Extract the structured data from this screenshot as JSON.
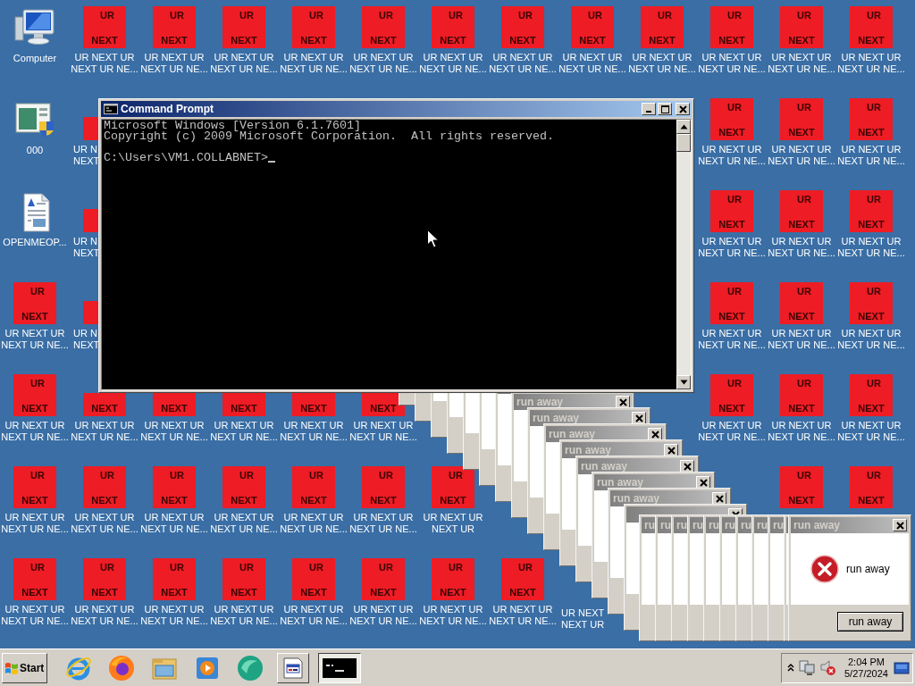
{
  "desktop": {
    "rows": [
      [
        {
          "kind": "computer",
          "label": [
            "Computer"
          ]
        },
        {
          "kind": "ur",
          "top": "UR",
          "bottom": "NEXT",
          "label": [
            "UR NEXT UR",
            "NEXT UR NE..."
          ]
        },
        {
          "kind": "ur",
          "top": "UR",
          "bottom": "NEXT",
          "label": [
            "UR NEXT UR",
            "NEXT UR NE..."
          ]
        },
        {
          "kind": "ur",
          "top": "UR",
          "bottom": "NEXT",
          "label": [
            "UR NEXT UR",
            "NEXT UR NE..."
          ]
        },
        {
          "kind": "ur",
          "top": "UR",
          "bottom": "NEXT",
          "label": [
            "UR NEXT UR",
            "NEXT UR NE..."
          ]
        },
        {
          "kind": "ur",
          "top": "UR",
          "bottom": "NEXT",
          "label": [
            "UR NEXT UR",
            "NEXT UR NE..."
          ]
        },
        {
          "kind": "ur",
          "top": "UR",
          "bottom": "NEXT",
          "label": [
            "UR NEXT UR",
            "NEXT UR NE..."
          ]
        },
        {
          "kind": "ur",
          "top": "UR",
          "bottom": "NEXT",
          "label": [
            "UR NEXT UR",
            "NEXT UR NE..."
          ]
        },
        {
          "kind": "ur",
          "top": "UR",
          "bottom": "NEXT",
          "label": [
            "UR NEXT UR",
            "NEXT UR NE..."
          ]
        },
        {
          "kind": "ur",
          "top": "UR",
          "bottom": "NEXT",
          "label": [
            "UR NEXT UR",
            "NEXT UR NE..."
          ]
        },
        {
          "kind": "ur",
          "top": "UR",
          "bottom": "NEXT",
          "label": [
            "UR NEXT UR",
            "NEXT UR NE..."
          ]
        },
        {
          "kind": "ur",
          "top": "UR",
          "bottom": "NEXT",
          "label": [
            "UR NEXT UR",
            "NEXT UR NE..."
          ]
        },
        {
          "kind": "ur",
          "top": "UR",
          "bottom": "NEXT",
          "label": [
            "UR NEXT UR",
            "NEXT UR NE..."
          ]
        }
      ],
      [
        {
          "kind": "program",
          "label": [
            "000"
          ]
        },
        {
          "kind": "ur-cut",
          "label": [
            "UR N",
            "NEXT"
          ]
        },
        {
          "kind": "empty"
        },
        {
          "kind": "empty"
        },
        {
          "kind": "empty"
        },
        {
          "kind": "empty"
        },
        {
          "kind": "empty"
        },
        {
          "kind": "empty"
        },
        {
          "kind": "empty"
        },
        {
          "kind": "empty"
        },
        {
          "kind": "ur",
          "top": "UR",
          "bottom": "NEXT",
          "label": [
            "UR NEXT UR",
            "NEXT UR NE..."
          ]
        },
        {
          "kind": "ur",
          "top": "UR",
          "bottom": "NEXT",
          "label": [
            "UR NEXT UR",
            "NEXT UR NE..."
          ]
        },
        {
          "kind": "ur",
          "top": "UR",
          "bottom": "NEXT",
          "label": [
            "UR NEXT UR",
            "NEXT UR NE..."
          ]
        }
      ],
      [
        {
          "kind": "document",
          "label": [
            "OPENMEOP..."
          ]
        },
        {
          "kind": "ur-cut",
          "label": [
            "UR N",
            "NEXT"
          ]
        },
        {
          "kind": "empty"
        },
        {
          "kind": "empty"
        },
        {
          "kind": "empty"
        },
        {
          "kind": "empty"
        },
        {
          "kind": "empty"
        },
        {
          "kind": "empty"
        },
        {
          "kind": "empty"
        },
        {
          "kind": "empty"
        },
        {
          "kind": "ur",
          "top": "UR",
          "bottom": "NEXT",
          "label": [
            "UR NEXT UR",
            "NEXT UR NE..."
          ]
        },
        {
          "kind": "ur",
          "top": "UR",
          "bottom": "NEXT",
          "label": [
            "UR NEXT UR",
            "NEXT UR NE..."
          ]
        },
        {
          "kind": "ur",
          "top": "UR",
          "bottom": "NEXT",
          "label": [
            "UR NEXT UR",
            "NEXT UR NE..."
          ]
        }
      ],
      [
        {
          "kind": "ur",
          "top": "UR",
          "bottom": "NEXT",
          "label": [
            "UR NEXT UR",
            "NEXT UR NE..."
          ]
        },
        {
          "kind": "ur-cut",
          "label": [
            "UR N",
            "NEXT"
          ]
        },
        {
          "kind": "empty"
        },
        {
          "kind": "empty"
        },
        {
          "kind": "empty"
        },
        {
          "kind": "empty"
        },
        {
          "kind": "empty"
        },
        {
          "kind": "empty"
        },
        {
          "kind": "empty"
        },
        {
          "kind": "empty"
        },
        {
          "kind": "ur",
          "top": "UR",
          "bottom": "NEXT",
          "label": [
            "UR NEXT UR",
            "NEXT UR NE..."
          ]
        },
        {
          "kind": "ur",
          "top": "UR",
          "bottom": "NEXT",
          "label": [
            "UR NEXT UR",
            "NEXT UR NE..."
          ]
        },
        {
          "kind": "ur",
          "top": "UR",
          "bottom": "NEXT",
          "label": [
            "UR NEXT UR",
            "NEXT UR NE..."
          ]
        }
      ],
      [
        {
          "kind": "ur",
          "top": "UR",
          "bottom": "NEXT",
          "label": [
            "UR NEXT UR",
            "NEXT UR NE..."
          ]
        },
        {
          "kind": "ur",
          "bottom": "NEXT",
          "label": [
            "UR NEXT UR",
            "NEXT UR NE..."
          ]
        },
        {
          "kind": "ur",
          "bottom": "NEXT",
          "label": [
            "UR NEXT UR",
            "NEXT UR NE..."
          ]
        },
        {
          "kind": "ur",
          "bottom": "NEXT",
          "label": [
            "UR NEXT UR",
            "NEXT UR NE..."
          ]
        },
        {
          "kind": "ur",
          "bottom": "NEXT",
          "label": [
            "UR NEXT UR",
            "NEXT UR NE..."
          ]
        },
        {
          "kind": "ur",
          "bottom": "NEXT",
          "label": [
            "UR NEXT UR",
            "NEXT UR NE..."
          ]
        },
        {
          "kind": "empty"
        },
        {
          "kind": "empty"
        },
        {
          "kind": "empty"
        },
        {
          "kind": "empty"
        },
        {
          "kind": "ur",
          "top": "UR",
          "bottom": "NEXT",
          "label": [
            "UR NEXT UR",
            "NEXT UR NE..."
          ]
        },
        {
          "kind": "ur",
          "top": "UR",
          "bottom": "NEXT",
          "label": [
            "UR NEXT UR",
            "NEXT UR NE..."
          ]
        },
        {
          "kind": "ur",
          "top": "UR",
          "bottom": "NEXT",
          "label": [
            "UR NEXT UR",
            "NEXT UR NE..."
          ]
        }
      ],
      [
        {
          "kind": "ur",
          "top": "UR",
          "bottom": "NEXT",
          "label": [
            "UR NEXT UR",
            "NEXT UR NE..."
          ]
        },
        {
          "kind": "ur",
          "top": "UR",
          "bottom": "NEXT",
          "label": [
            "UR NEXT UR",
            "NEXT UR NE..."
          ]
        },
        {
          "kind": "ur",
          "top": "UR",
          "bottom": "NEXT",
          "label": [
            "UR NEXT UR",
            "NEXT UR NE..."
          ]
        },
        {
          "kind": "ur",
          "top": "UR",
          "bottom": "NEXT",
          "label": [
            "UR NEXT UR",
            "NEXT UR NE..."
          ]
        },
        {
          "kind": "ur",
          "top": "UR",
          "bottom": "NEXT",
          "label": [
            "UR NEXT UR",
            "NEXT UR NE..."
          ]
        },
        {
          "kind": "ur",
          "top": "UR",
          "bottom": "NEXT",
          "label": [
            "UR NEXT UR",
            "NEXT UR NE..."
          ]
        },
        {
          "kind": "ur",
          "top": "UR",
          "bottom": "NEXT",
          "label": [
            "UR NEXT UR",
            "NEXT UR"
          ]
        },
        {
          "kind": "empty"
        },
        {
          "kind": "empty"
        },
        {
          "kind": "empty"
        },
        {
          "kind": "empty"
        },
        {
          "kind": "ur",
          "top": "UR",
          "bottom": "NEXT"
        },
        {
          "kind": "ur",
          "top": "UR",
          "bottom": "NEXT"
        }
      ],
      [
        {
          "kind": "ur",
          "top": "UR",
          "bottom": "NEXT",
          "label": [
            "UR NEXT UR",
            "NEXT UR NE..."
          ]
        },
        {
          "kind": "ur",
          "top": "UR",
          "bottom": "NEXT",
          "label": [
            "UR NEXT UR",
            "NEXT UR NE..."
          ]
        },
        {
          "kind": "ur",
          "top": "UR",
          "bottom": "NEXT",
          "label": [
            "UR NEXT UR",
            "NEXT UR NE..."
          ]
        },
        {
          "kind": "ur",
          "top": "UR",
          "bottom": "NEXT",
          "label": [
            "UR NEXT UR",
            "NEXT UR NE..."
          ]
        },
        {
          "kind": "ur",
          "top": "UR",
          "bottom": "NEXT",
          "label": [
            "UR NEXT UR",
            "NEXT UR NE..."
          ]
        },
        {
          "kind": "ur",
          "top": "UR",
          "bottom": "NEXT",
          "label": [
            "UR NEXT UR",
            "NEXT UR NE..."
          ]
        },
        {
          "kind": "ur",
          "top": "UR",
          "bottom": "NEXT",
          "label": [
            "UR NEXT UR",
            "NEXT UR NE..."
          ]
        },
        {
          "kind": "ur",
          "top": "UR",
          "bottom": "NEXT",
          "label": [
            "UR NEXT UR",
            "NEXT UR NE..."
          ]
        },
        {
          "kind": "label-only",
          "label": [
            "UR NEXT",
            "NEXT UR"
          ]
        },
        {
          "kind": "empty"
        },
        {
          "kind": "empty"
        },
        {
          "kind": "empty"
        },
        {
          "kind": "empty"
        }
      ]
    ]
  },
  "cascade": [
    {
      "kind": "frame"
    },
    {
      "kind": "frame"
    },
    {
      "kind": "window"
    },
    {
      "kind": "window"
    },
    {
      "kind": "window"
    },
    {
      "kind": "window"
    },
    {
      "kind": "window"
    },
    {
      "kind": "window",
      "title": "run away",
      "close": true
    },
    {
      "kind": "window",
      "title": "run away",
      "close": true
    },
    {
      "kind": "window",
      "title": "run away",
      "close": true
    },
    {
      "kind": "window",
      "title": "run away",
      "close": true
    },
    {
      "kind": "window",
      "title": "run away",
      "close": true
    },
    {
      "kind": "window",
      "title": "run away",
      "close": true
    },
    {
      "kind": "window",
      "title": "run away",
      "close": true
    },
    {
      "kind": "window",
      "close": true
    }
  ],
  "stack": [
    {
      "kind": "window",
      "title": "ru"
    },
    {
      "kind": "window",
      "title": "ru"
    },
    {
      "kind": "window",
      "title": "ru"
    },
    {
      "kind": "window",
      "title": "ru"
    },
    {
      "kind": "window",
      "title": "ru"
    },
    {
      "kind": "window",
      "title": "ru"
    },
    {
      "kind": "window",
      "title": "ru"
    },
    {
      "kind": "window",
      "title": "ru"
    },
    {
      "kind": "window",
      "title": "ru"
    },
    {
      "kind": "window"
    }
  ],
  "dialog": {
    "kind": "error",
    "title": "run away",
    "close": true,
    "message": "run away",
    "button": "run away"
  },
  "console": {
    "title": "Command Prompt",
    "output": [
      "Microsoft Windows [Version 6.1.7601]",
      "Copyright (c) 2009 Microsoft Corporation.  All rights reserved."
    ],
    "prompt": "C:\\Users\\VM1.COLLABNET>"
  },
  "taskbar": {
    "start": "Start",
    "quick_launch": [
      {
        "kind": "ie"
      },
      {
        "kind": "firefox"
      },
      {
        "kind": "explorer"
      },
      {
        "kind": "media"
      },
      {
        "kind": "chat"
      }
    ],
    "tasks": [
      {
        "kind": "document",
        "selected": false
      },
      {
        "kind": "console",
        "selected": true
      }
    ],
    "tray": {
      "icons": [
        {
          "kind": "chevron"
        },
        {
          "kind": "network"
        },
        {
          "kind": "volume-muted"
        }
      ],
      "time": "2:04 PM",
      "date": "5/27/2024"
    }
  }
}
